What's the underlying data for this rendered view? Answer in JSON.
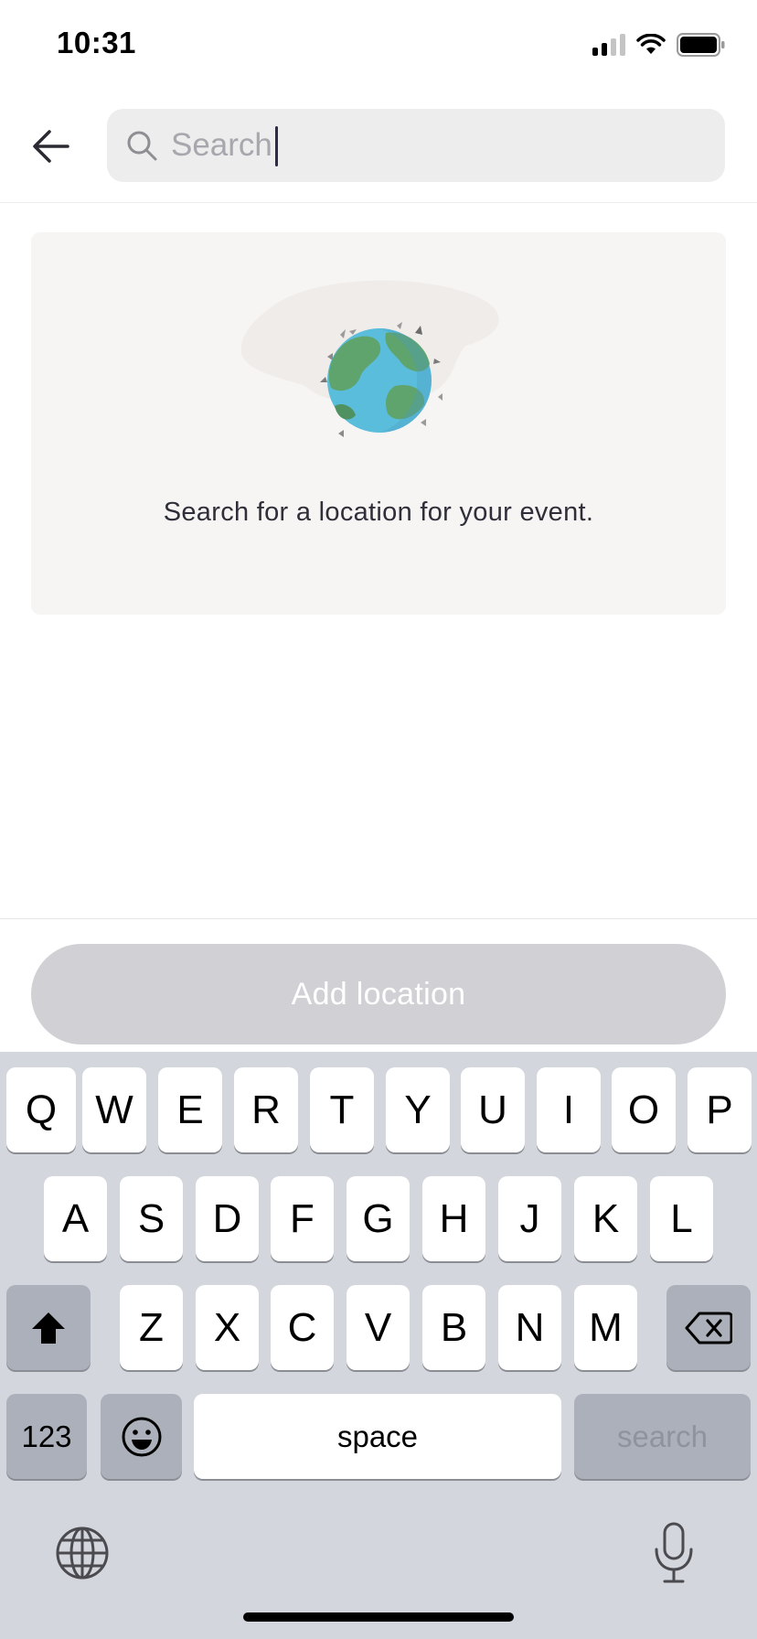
{
  "status_bar": {
    "time": "10:31",
    "icons": [
      "signal-icon",
      "wifi-icon",
      "battery-icon"
    ]
  },
  "header": {
    "back_icon": "arrow-left-icon",
    "search": {
      "placeholder": "Search",
      "value": "",
      "icon": "search-icon"
    }
  },
  "empty_state": {
    "illustration": "globe-icon",
    "message": "Search for a location for your event."
  },
  "action": {
    "add_label": "Add location",
    "enabled": false
  },
  "keyboard": {
    "row1": [
      "Q",
      "W",
      "E",
      "R",
      "T",
      "Y",
      "U",
      "I",
      "O",
      "P"
    ],
    "row2": [
      "A",
      "S",
      "D",
      "F",
      "G",
      "H",
      "J",
      "K",
      "L"
    ],
    "row3": [
      "Z",
      "X",
      "C",
      "V",
      "B",
      "N",
      "M"
    ],
    "numbers_label": "123",
    "space_label": "space",
    "search_label": "search",
    "shift_icon": "shift-icon",
    "backspace_icon": "backspace-icon",
    "emoji_icon": "emoji-icon",
    "globe_icon": "globe-icon",
    "mic_icon": "microphone-icon"
  },
  "colors": {
    "accent": "#2d2a4a",
    "card_bg": "#f7f5f3",
    "disabled_button": "#d1d0d4",
    "keyboard_bg": "#d3d6dc"
  }
}
